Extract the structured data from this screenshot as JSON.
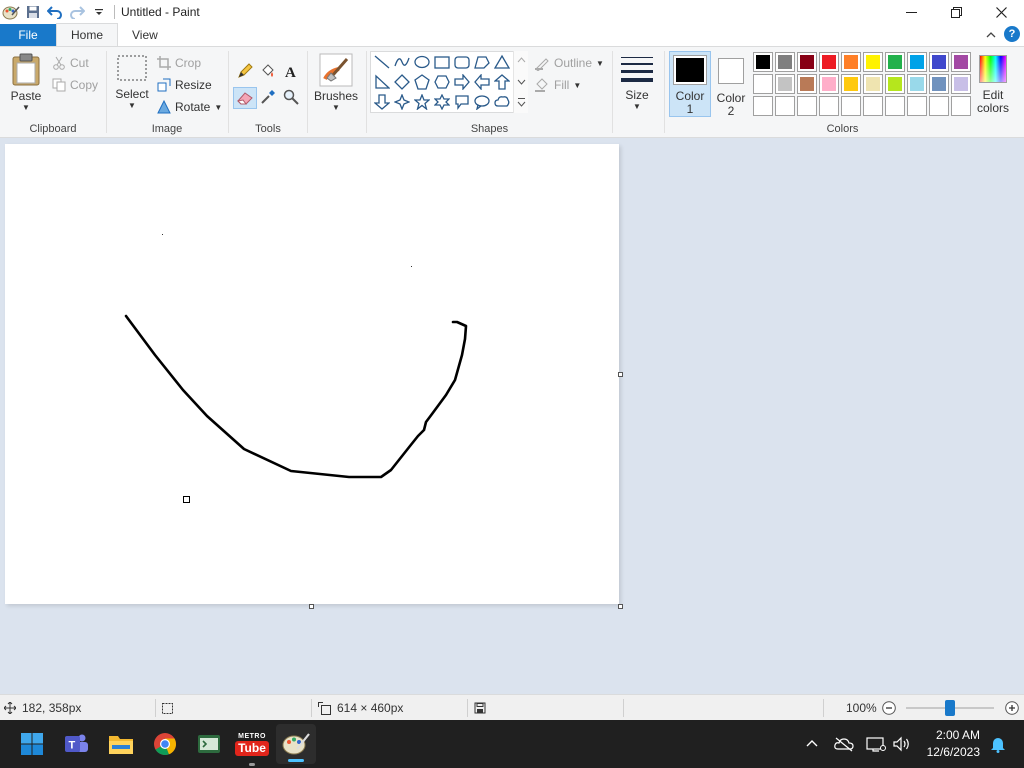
{
  "window": {
    "title": "Untitled - Paint"
  },
  "tabs": {
    "file": "File",
    "home": "Home",
    "view": "View",
    "help": "?"
  },
  "ribbon": {
    "clipboard": {
      "label": "Clipboard",
      "paste": "Paste",
      "cut": "Cut",
      "copy": "Copy"
    },
    "image": {
      "label": "Image",
      "select": "Select",
      "crop": "Crop",
      "resize": "Resize",
      "rotate": "Rotate"
    },
    "tools": {
      "label": "Tools"
    },
    "brushes": {
      "label": "Brushes"
    },
    "shapes": {
      "label": "Shapes",
      "outline": "Outline",
      "fill": "Fill"
    },
    "size": {
      "label": "Size"
    },
    "colors": {
      "label": "Colors",
      "color1": "Color",
      "color1_num": "1",
      "color2": "Color",
      "color2_num": "2",
      "edit1": "Edit",
      "edit2": "colors",
      "color1_value": "#000000",
      "color2_value": "#ffffff",
      "palette": [
        "#000000",
        "#7f7f7f",
        "#880015",
        "#ed1c24",
        "#ff7f27",
        "#fff200",
        "#22b14c",
        "#00a2e8",
        "#3f48cc",
        "#a349a4",
        "#ffffff",
        "#c3c3c3",
        "#b97a57",
        "#ffaec9",
        "#ffc90e",
        "#efe4b0",
        "#b5e61d",
        "#99d9ea",
        "#7092be",
        "#c8bfe7",
        "#ffffff",
        "#ffffff",
        "#ffffff",
        "#ffffff",
        "#ffffff",
        "#ffffff",
        "#ffffff",
        "#ffffff",
        "#ffffff",
        "#ffffff"
      ]
    }
  },
  "status": {
    "cursor_pos": "182, 358px",
    "canvas_size": "614 × 460px",
    "zoom": "100%",
    "zoom_fraction": 0.5
  },
  "taskbar": {
    "time": "2:00 AM",
    "date": "12/6/2023",
    "metro_label": "METRO",
    "tube_label": "Tube"
  }
}
